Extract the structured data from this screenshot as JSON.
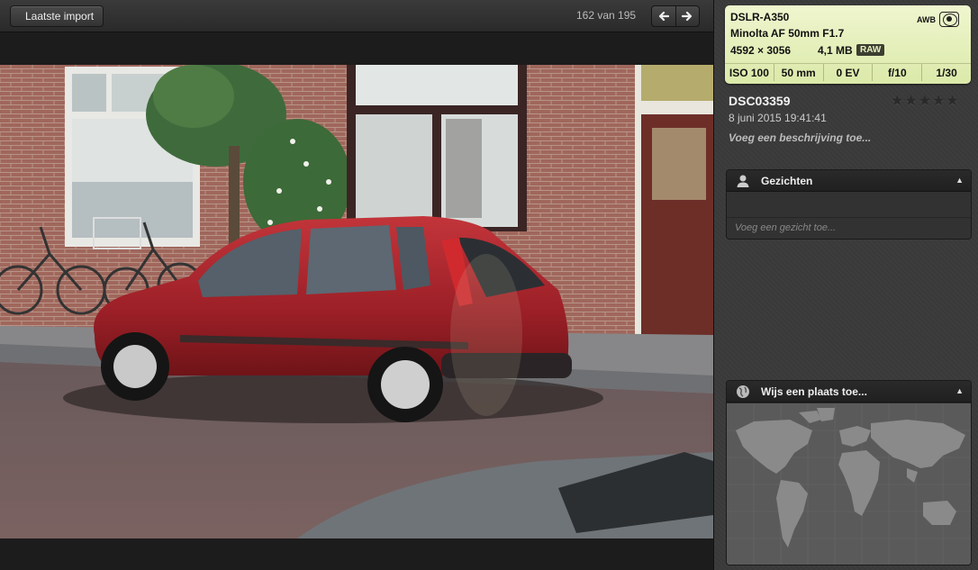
{
  "toolbar": {
    "back_label": "Laatste import",
    "counter": "162 van 195",
    "prev_icon": "arrow-left-icon",
    "next_icon": "arrow-right-icon"
  },
  "photo": {
    "description_visible": "street photo of a red hatchback parked in front of brick houses"
  },
  "exif": {
    "camera": "DSLR-A350",
    "lens": "Minolta AF 50mm F1.7",
    "dimensions": "4592 × 3056",
    "file_size": "4,1 MB",
    "format_badge": "RAW",
    "white_balance": "AWB",
    "metering_icon": "metering-icon",
    "iso": "ISO 100",
    "focal_length": "50 mm",
    "exposure_comp": "0 EV",
    "aperture": "f/10",
    "shutter": "1/30",
    "background_color": "#e5efbb"
  },
  "info": {
    "filename": "DSC03359",
    "date": "8 juni 2015 19:41:41",
    "description_placeholder": "Voeg een beschrijving toe...",
    "rating": 0,
    "stars": "★★★★★"
  },
  "faces_panel": {
    "title": "Gezichten",
    "toggle": "▲",
    "add_placeholder": "Voeg een gezicht toe..."
  },
  "places_panel": {
    "title": "Wijs een plaats toe...",
    "toggle": "▲"
  }
}
